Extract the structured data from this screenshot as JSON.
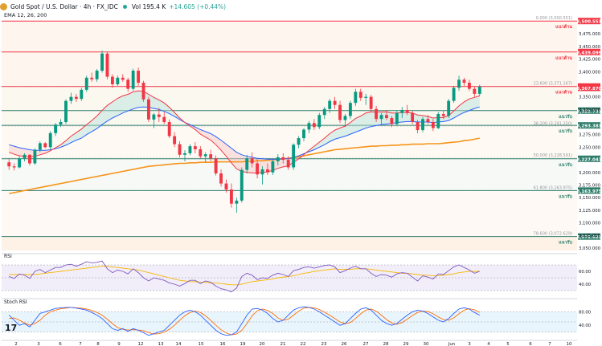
{
  "header": {
    "symbol": "Gold Spot / U.S. Dollar · 4h · FX_IDC",
    "volume": "Vol 195.4 K",
    "change": "+14.605 (+0.44%)",
    "ema_label": "EMA 12, 26, 200"
  },
  "panels": {
    "rsi_label": "RSI",
    "stoch_label": "Stoch RSI"
  },
  "chart_data": {
    "type": "candlestick",
    "x_axis": {
      "tick_labels": [
        "2",
        "3",
        "6",
        "7",
        "8",
        "9",
        "12",
        "13",
        "14",
        "15",
        "16",
        "19",
        "20",
        "21",
        "22",
        "23",
        "26",
        "27",
        "28",
        "29",
        "30",
        "Jun",
        "3",
        "4",
        "5",
        "6",
        "7",
        "10"
      ]
    },
    "y_axis": {
      "ylim": [
        3045,
        3520
      ],
      "tick_labels": [
        "3,475.000",
        "3,450.000",
        "3,425.000",
        "3,400.000",
        "3,350.000",
        "3,325.000",
        "3,275.000",
        "3,250.000",
        "3,200.000",
        "3,175.000",
        "3,150.000",
        "3,125.000",
        "3,100.000",
        "3,075.000",
        "3,050.000"
      ]
    },
    "candles": [
      [
        3220,
        3226,
        3205,
        3212
      ],
      [
        3212,
        3218,
        3204,
        3210
      ],
      [
        3210,
        3232,
        3208,
        3228
      ],
      [
        3228,
        3238,
        3222,
        3235
      ],
      [
        3235,
        3236,
        3214,
        3218
      ],
      [
        3218,
        3248,
        3215,
        3245
      ],
      [
        3245,
        3262,
        3240,
        3258
      ],
      [
        3258,
        3260,
        3248,
        3250
      ],
      [
        3250,
        3282,
        3246,
        3278
      ],
      [
        3278,
        3298,
        3272,
        3295
      ],
      [
        3295,
        3306,
        3290,
        3300
      ],
      [
        3300,
        3345,
        3296,
        3342
      ],
      [
        3342,
        3358,
        3336,
        3350
      ],
      [
        3350,
        3356,
        3340,
        3346
      ],
      [
        3346,
        3368,
        3342,
        3364
      ],
      [
        3364,
        3392,
        3360,
        3388
      ],
      [
        3388,
        3398,
        3380,
        3385
      ],
      [
        3385,
        3405,
        3380,
        3402
      ],
      [
        3402,
        3442,
        3398,
        3436
      ],
      [
        3436,
        3440,
        3385,
        3390
      ],
      [
        3390,
        3395,
        3368,
        3375
      ],
      [
        3375,
        3392,
        3372,
        3388
      ],
      [
        3388,
        3395,
        3380,
        3384
      ],
      [
        3384,
        3388,
        3360,
        3366
      ],
      [
        3366,
        3406,
        3362,
        3402
      ],
      [
        3402,
        3408,
        3372,
        3378
      ],
      [
        3378,
        3382,
        3340,
        3345
      ],
      [
        3345,
        3350,
        3300,
        3305
      ],
      [
        3305,
        3318,
        3288,
        3315
      ],
      [
        3315,
        3328,
        3300,
        3310
      ],
      [
        3310,
        3320,
        3296,
        3300
      ],
      [
        3300,
        3305,
        3268,
        3272
      ],
      [
        3272,
        3280,
        3250,
        3256
      ],
      [
        3256,
        3262,
        3230,
        3235
      ],
      [
        3235,
        3244,
        3222,
        3238
      ],
      [
        3238,
        3256,
        3234,
        3252
      ],
      [
        3252,
        3260,
        3238,
        3246
      ],
      [
        3246,
        3252,
        3228,
        3232
      ],
      [
        3232,
        3240,
        3220,
        3236
      ],
      [
        3236,
        3245,
        3222,
        3228
      ],
      [
        3228,
        3234,
        3194,
        3198
      ],
      [
        3198,
        3206,
        3172,
        3178
      ],
      [
        3178,
        3186,
        3160,
        3166
      ],
      [
        3166,
        3178,
        3130,
        3138
      ],
      [
        3138,
        3150,
        3120,
        3144
      ],
      [
        3144,
        3210,
        3140,
        3205
      ],
      [
        3205,
        3235,
        3198,
        3228
      ],
      [
        3228,
        3240,
        3210,
        3218
      ],
      [
        3218,
        3226,
        3188,
        3196
      ],
      [
        3196,
        3212,
        3176,
        3206
      ],
      [
        3206,
        3218,
        3195,
        3200
      ],
      [
        3200,
        3225,
        3195,
        3222
      ],
      [
        3222,
        3236,
        3214,
        3230
      ],
      [
        3230,
        3238,
        3218,
        3225
      ],
      [
        3225,
        3232,
        3205,
        3210
      ],
      [
        3210,
        3258,
        3205,
        3255
      ],
      [
        3255,
        3272,
        3248,
        3268
      ],
      [
        3268,
        3288,
        3262,
        3285
      ],
      [
        3285,
        3302,
        3278,
        3298
      ],
      [
        3298,
        3306,
        3284,
        3290
      ],
      [
        3290,
        3318,
        3286,
        3314
      ],
      [
        3314,
        3330,
        3306,
        3326
      ],
      [
        3326,
        3346,
        3318,
        3342
      ],
      [
        3342,
        3350,
        3326,
        3334
      ],
      [
        3334,
        3342,
        3298,
        3304
      ],
      [
        3304,
        3316,
        3290,
        3312
      ],
      [
        3312,
        3342,
        3306,
        3338
      ],
      [
        3338,
        3366,
        3332,
        3360
      ],
      [
        3360,
        3366,
        3342,
        3348
      ],
      [
        3348,
        3356,
        3334,
        3350
      ],
      [
        3350,
        3354,
        3320,
        3326
      ],
      [
        3326,
        3332,
        3300,
        3306
      ],
      [
        3306,
        3318,
        3296,
        3314
      ],
      [
        3314,
        3324,
        3304,
        3308
      ],
      [
        3308,
        3312,
        3290,
        3296
      ],
      [
        3296,
        3322,
        3292,
        3318
      ],
      [
        3318,
        3330,
        3308,
        3324
      ],
      [
        3324,
        3334,
        3314,
        3318
      ],
      [
        3318,
        3322,
        3296,
        3300
      ],
      [
        3300,
        3304,
        3278,
        3284
      ],
      [
        3284,
        3310,
        3280,
        3306
      ],
      [
        3306,
        3314,
        3296,
        3300
      ],
      [
        3300,
        3306,
        3282,
        3288
      ],
      [
        3288,
        3320,
        3286,
        3316
      ],
      [
        3316,
        3322,
        3306,
        3312
      ],
      [
        3312,
        3346,
        3308,
        3342
      ],
      [
        3342,
        3372,
        3338,
        3368
      ],
      [
        3368,
        3392,
        3362,
        3384
      ],
      [
        3384,
        3388,
        3372,
        3378
      ],
      [
        3378,
        3384,
        3362,
        3366
      ],
      [
        3366,
        3370,
        3350,
        3356
      ],
      [
        3356,
        3374,
        3352,
        3370
      ]
    ],
    "ema12": [
      3240,
      3236,
      3233,
      3232,
      3231,
      3232,
      3235,
      3238,
      3243,
      3249,
      3255,
      3263,
      3272,
      3279,
      3286,
      3295,
      3303,
      3312,
      3323,
      3333,
      3340,
      3347,
      3352,
      3355,
      3360,
      3362,
      3361,
      3355,
      3349,
      3344,
      3338,
      3329,
      3319,
      3308,
      3299,
      3292,
      3285,
      3276,
      3270,
      3264,
      3255,
      3244,
      3232,
      3219,
      3207,
      3202,
      3200,
      3199,
      3199,
      3200,
      3201,
      3204,
      3208,
      3211,
      3213,
      3220,
      3227,
      3235,
      3244,
      3252,
      3260,
      3268,
      3277,
      3284,
      3288,
      3292,
      3299,
      3307,
      3312,
      3318,
      3320,
      3320,
      3320,
      3320,
      3318,
      3318,
      3319,
      3319,
      3318,
      3314,
      3313,
      3311,
      3308,
      3309,
      3309,
      3313,
      3322,
      3332,
      3340,
      3346,
      3349,
      3352
    ],
    "ema26": [
      3255,
      3252,
      3249,
      3247,
      3245,
      3244,
      3244,
      3244,
      3245,
      3247,
      3250,
      3254,
      3259,
      3264,
      3268,
      3275,
      3281,
      3287,
      3295,
      3302,
      3308,
      3313,
      3318,
      3322,
      3326,
      3329,
      3330,
      3329,
      3327,
      3325,
      3321,
      3317,
      3311,
      3305,
      3299,
      3295,
      3290,
      3285,
      3281,
      3277,
      3271,
      3264,
      3256,
      3248,
      3240,
      3235,
      3232,
      3230,
      3228,
      3227,
      3226,
      3226,
      3226,
      3227,
      3227,
      3230,
      3233,
      3237,
      3241,
      3245,
      3250,
      3255,
      3261,
      3266,
      3269,
      3272,
      3276,
      3280,
      3284,
      3288,
      3291,
      3293,
      3295,
      3296,
      3297,
      3299,
      3300,
      3301,
      3301,
      3300,
      3300,
      3300,
      3299,
      3300,
      3301,
      3303,
      3308,
      3314,
      3319,
      3323,
      3327,
      3330
    ],
    "ema200": [
      3158,
      3160,
      3162,
      3164,
      3166,
      3168,
      3170,
      3172,
      3174,
      3176,
      3178,
      3180,
      3182,
      3184,
      3186,
      3188,
      3190,
      3192,
      3194,
      3196,
      3198,
      3200,
      3202,
      3204,
      3206,
      3208,
      3210,
      3212,
      3213,
      3214,
      3215,
      3216,
      3217,
      3218,
      3218,
      3219,
      3219,
      3220,
      3220,
      3220,
      3221,
      3221,
      3221,
      3221,
      3221,
      3221,
      3222,
      3222,
      3223,
      3223,
      3224,
      3225,
      3226,
      3227,
      3228,
      3229,
      3231,
      3233,
      3235,
      3237,
      3239,
      3241,
      3243,
      3245,
      3246,
      3247,
      3248,
      3249,
      3250,
      3251,
      3252,
      3252,
      3253,
      3253,
      3254,
      3254,
      3255,
      3255,
      3256,
      3256,
      3256,
      3257,
      3257,
      3257,
      3258,
      3259,
      3260,
      3261,
      3263,
      3264,
      3266,
      3268
    ],
    "resistance_lines": [
      {
        "value": 3500.551,
        "label": "3,500.551",
        "zone": "แนวต้าน",
        "color": "#f23645"
      },
      {
        "value": 3439.099,
        "label": "3,439.099",
        "zone": "แนวต้าน",
        "color": "#f23645"
      },
      {
        "value": 3370.59,
        "label": "3,370.590",
        "zone": "แนวต้าน",
        "color": "#f23645"
      }
    ],
    "support_lines": [
      {
        "value": 3322.731,
        "label": "3,322.731",
        "zone": "แนวรับ",
        "color": "#2e7d6b"
      },
      {
        "value": 3293.381,
        "label": "3,293.381",
        "zone": "แนวรับ",
        "color": "#2e7d6b"
      },
      {
        "value": 3227.047,
        "label": "3,227.047",
        "zone": "แนวรับ",
        "color": "#2e7d6b"
      },
      {
        "value": 3163.975,
        "label": "3,163.975",
        "zone": "แนวรับ",
        "color": "#2e7d6b"
      },
      {
        "value": 3072.629,
        "label": "3,072.629",
        "zone": "แนวรับ",
        "color": "#2e7d6b"
      }
    ],
    "current_price": {
      "value": 3367.87,
      "label": "3,367.870"
    },
    "fib_levels": [
      {
        "value": 3500.551,
        "label": "0.000 (3,500.551)"
      },
      {
        "value": 3371.167,
        "label": "23.600 (3,371.167)"
      },
      {
        "value": 3291.25,
        "label": "38.200 (3,291.250)"
      },
      {
        "value": 3228.591,
        "label": "50.000 (3,228.591)"
      },
      {
        "value": 3163.975,
        "label": "61.800 (3,163.975)"
      },
      {
        "value": 3072.629,
        "label": "78.600 (3,072.629)"
      }
    ],
    "rsi": {
      "levels": [
        "60.00",
        "40.00"
      ],
      "ylim": [
        25,
        80
      ],
      "values": [
        52,
        49,
        56,
        54,
        49,
        60,
        63,
        58,
        62,
        66,
        66,
        70,
        71,
        68,
        71,
        75,
        73,
        74,
        76,
        64,
        58,
        62,
        60,
        56,
        64,
        58,
        50,
        45,
        50,
        48,
        46,
        42,
        40,
        37,
        41,
        46,
        46,
        41,
        45,
        43,
        37,
        33,
        31,
        28,
        34,
        52,
        57,
        54,
        47,
        50,
        49,
        54,
        57,
        55,
        52,
        61,
        63,
        66,
        67,
        65,
        67,
        69,
        70,
        67,
        58,
        61,
        65,
        68,
        64,
        64,
        57,
        52,
        55,
        54,
        51,
        56,
        58,
        57,
        51,
        45,
        53,
        51,
        48,
        56,
        55,
        61,
        67,
        70,
        66,
        62,
        57,
        60
      ],
      "ma": [
        55,
        55,
        55,
        55,
        55,
        55,
        56,
        57,
        58,
        59,
        60,
        61,
        62,
        63,
        64,
        65,
        66,
        67,
        68,
        68,
        67,
        66,
        65,
        64,
        63,
        62,
        60,
        58,
        56,
        54,
        52,
        50,
        48,
        46,
        45,
        44,
        44,
        43,
        43,
        42,
        42,
        41,
        40,
        39,
        39,
        40,
        42,
        44,
        45,
        46,
        47,
        48,
        50,
        51,
        52,
        53,
        55,
        57,
        58,
        60,
        61,
        62,
        63,
        64,
        63,
        63,
        63,
        64,
        64,
        64,
        63,
        62,
        61,
        60,
        59,
        58,
        57,
        57,
        56,
        55,
        54,
        54,
        53,
        53,
        54,
        55,
        56,
        58,
        59,
        60,
        60,
        60
      ]
    },
    "stoch_rsi": {
      "levels": [
        "80.00",
        "40.00"
      ],
      "ylim": [
        0,
        100
      ],
      "k": [
        70,
        55,
        40,
        45,
        35,
        55,
        75,
        80,
        85,
        90,
        92,
        93,
        93,
        91,
        88,
        85,
        78,
        70,
        60,
        45,
        30,
        25,
        30,
        22,
        30,
        25,
        18,
        10,
        15,
        20,
        25,
        40,
        55,
        70,
        80,
        85,
        80,
        70,
        55,
        40,
        25,
        15,
        10,
        12,
        20,
        45,
        70,
        88,
        90,
        85,
        75,
        60,
        50,
        55,
        70,
        85,
        92,
        95,
        93,
        88,
        80,
        70,
        60,
        50,
        40,
        45,
        60,
        75,
        88,
        92,
        85,
        70,
        55,
        45,
        40,
        45,
        58,
        70,
        80,
        85,
        82,
        75,
        65,
        55,
        50,
        60,
        75,
        88,
        92,
        88,
        78,
        70
      ],
      "d": [
        60,
        62,
        55,
        47,
        40,
        45,
        55,
        70,
        80,
        85,
        89,
        91,
        93,
        92,
        91,
        88,
        84,
        78,
        70,
        58,
        45,
        33,
        28,
        26,
        27,
        26,
        24,
        18,
        14,
        15,
        20,
        28,
        40,
        55,
        68,
        78,
        82,
        78,
        68,
        55,
        40,
        27,
        17,
        12,
        14,
        25,
        45,
        68,
        83,
        88,
        84,
        75,
        62,
        55,
        58,
        70,
        82,
        91,
        93,
        92,
        87,
        79,
        70,
        60,
        50,
        45,
        48,
        60,
        74,
        85,
        88,
        82,
        70,
        57,
        47,
        43,
        48,
        58,
        69,
        78,
        82,
        81,
        74,
        65,
        57,
        55,
        62,
        74,
        85,
        89,
        86,
        78
      ]
    }
  }
}
